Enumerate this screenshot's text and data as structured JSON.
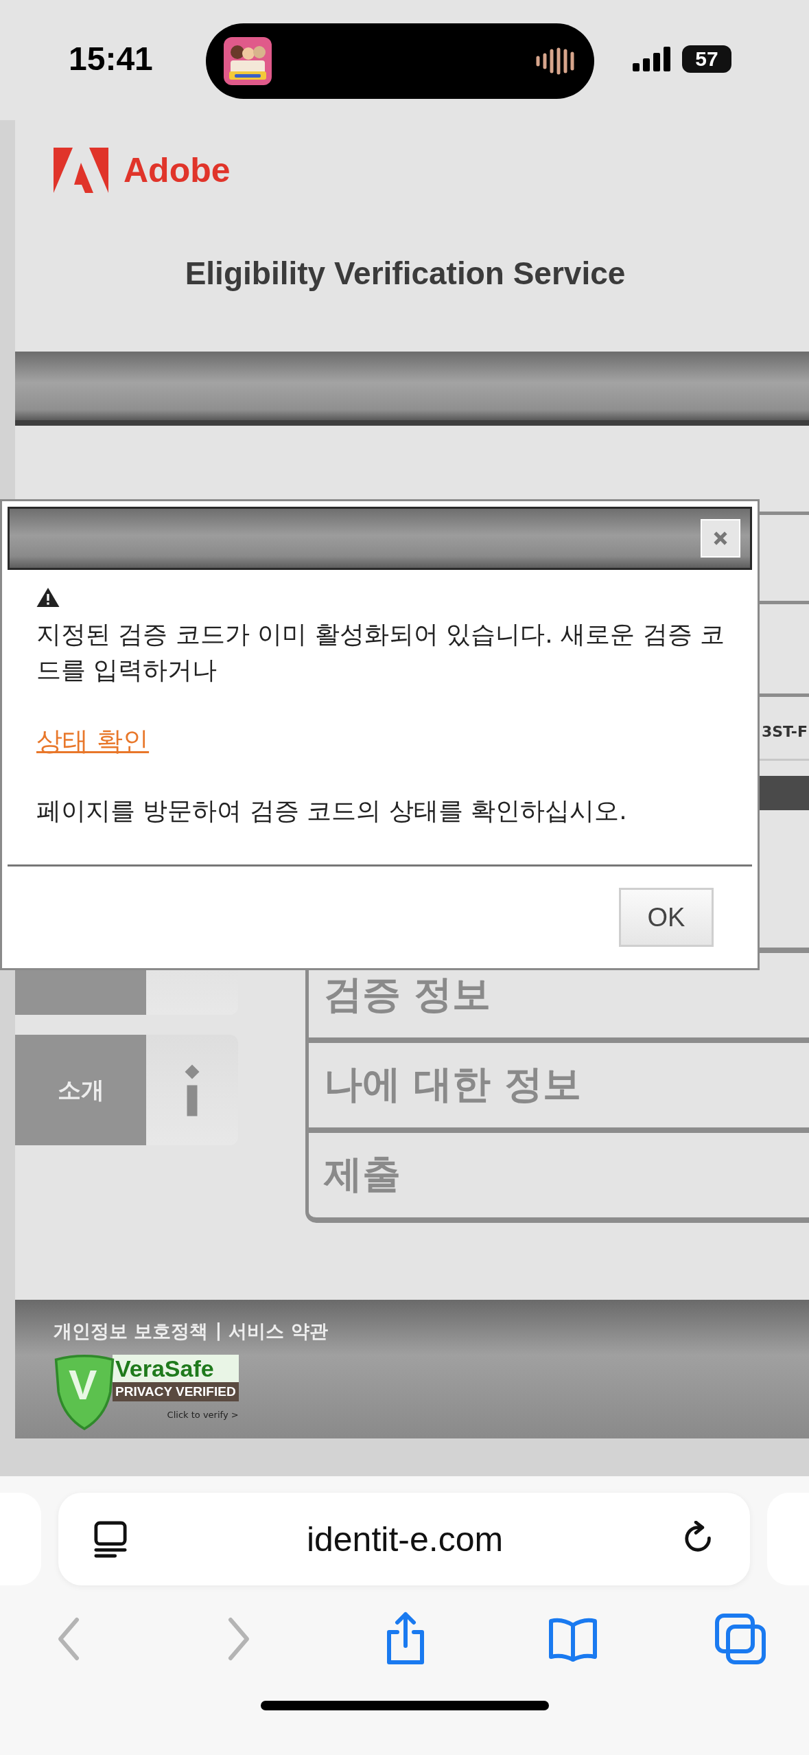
{
  "status_bar": {
    "time": "15:41",
    "battery": "57"
  },
  "header": {
    "logo": "Adobe",
    "title": "Eligibility Verification Service"
  },
  "side_tiles": [
    {
      "label": "소개"
    }
  ],
  "background_field": {
    "value": "3ST-F"
  },
  "steps": [
    {
      "label": "검증 정보"
    },
    {
      "label": "나에 대한 정보"
    },
    {
      "label": "제출"
    }
  ],
  "dialog": {
    "message": "지정된 검증 코드가 이미 활성화되어 있습니다. 새로운 검증 코드를 입력하거나",
    "link": "상태 확인",
    "note": "페이지를 방문하여 검증 코드의 상태를 확인하십시오.",
    "ok_button": "OK"
  },
  "footer": {
    "links": [
      "개인정보 보호정책",
      "서비스 약관"
    ],
    "separator": "|",
    "badge": {
      "mark": "V",
      "brand": "VeraSafe",
      "caption": "PRIVACY VERIFIED",
      "action": "Click to verify >"
    }
  },
  "browser": {
    "url": "identit-e.com",
    "toolbar": [
      {
        "kind": "back",
        "disabled": true
      },
      {
        "kind": "forward",
        "disabled": true
      },
      {
        "kind": "share",
        "disabled": false
      },
      {
        "kind": "bookmarks",
        "disabled": false
      },
      {
        "kind": "tabs",
        "disabled": false
      }
    ]
  }
}
